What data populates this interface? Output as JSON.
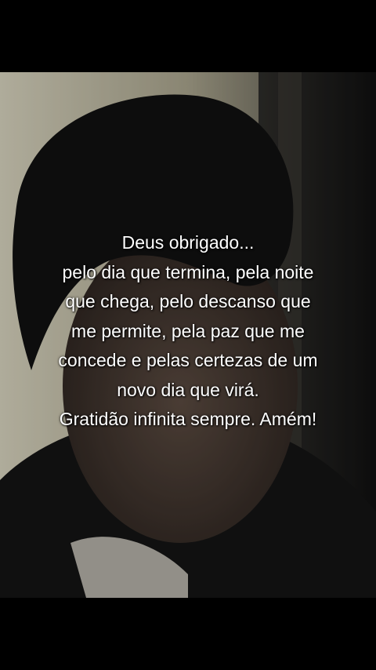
{
  "caption": {
    "lines": [
      "Deus obrigado...",
      "pelo dia que termina, pela noite",
      "que chega, pelo descanso que",
      "me permite, pela paz que me",
      "concede e pelas certezas de um",
      "novo dia que virá.",
      "Gratidão infinita sempre. Amém!"
    ]
  },
  "colors": {
    "letterbox": "#000000",
    "text": "#ffffff",
    "wall": "#b9b39c",
    "hair": "#121212",
    "skin": "#4a3d35"
  }
}
